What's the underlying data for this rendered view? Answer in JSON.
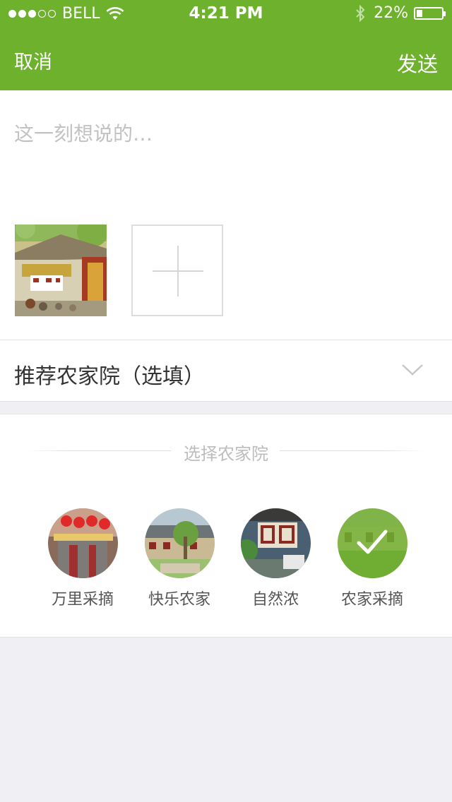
{
  "status_bar": {
    "carrier": "BELL",
    "time": "4:21 PM",
    "battery_pct": "22%",
    "signal_bars": 3,
    "battery_level": 0.22
  },
  "nav": {
    "cancel_label": "取消",
    "send_label": "发送"
  },
  "compose": {
    "placeholder": "这一刻想说的…"
  },
  "recommend": {
    "label": "推荐农家院（选填）"
  },
  "picker": {
    "title": "选择农家院",
    "farms": [
      {
        "name": "万里采摘",
        "selected": false
      },
      {
        "name": "快乐农家",
        "selected": false
      },
      {
        "name": "自然浓",
        "selected": false
      },
      {
        "name": "农家采摘",
        "selected": true
      }
    ]
  },
  "colors": {
    "accent": "#6db12c",
    "page_bg": "#efeff4"
  }
}
